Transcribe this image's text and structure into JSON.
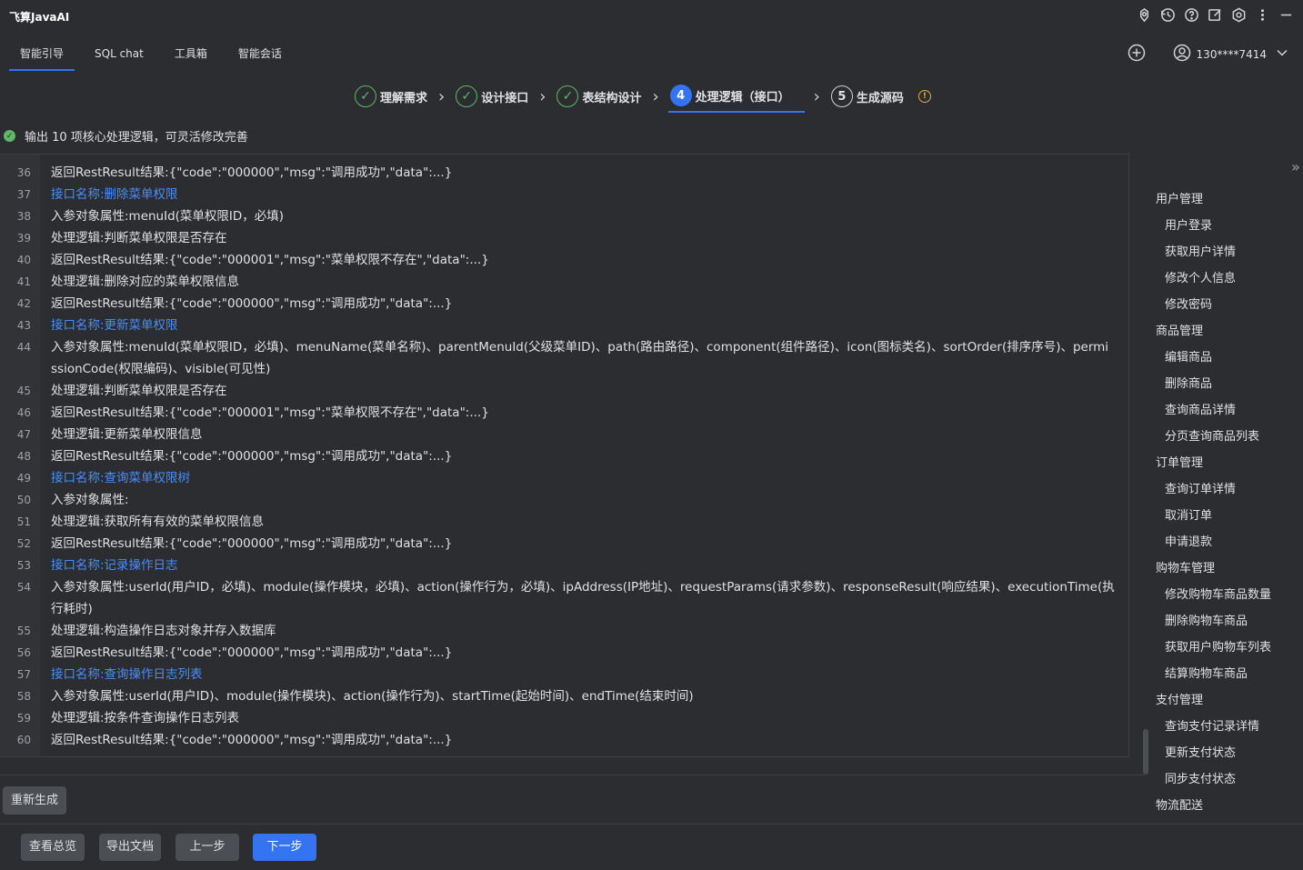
{
  "app": {
    "title": "飞算JavaAI"
  },
  "tabs": [
    {
      "label": "智能引导",
      "active": true
    },
    {
      "label": "SQL chat"
    },
    {
      "label": "工具箱"
    },
    {
      "label": "智能会话"
    }
  ],
  "user": {
    "phone": "130****7414"
  },
  "steps": [
    {
      "label": "理解需求",
      "state": "done"
    },
    {
      "label": "设计接口",
      "state": "done"
    },
    {
      "label": "表结构设计",
      "state": "done"
    },
    {
      "num": "4",
      "label": "处理逻辑（接口）",
      "state": "active"
    },
    {
      "num": "5",
      "label": "生成源码",
      "state": "todo"
    }
  ],
  "status": {
    "text": "输出 10 项核心处理逻辑，可灵活修改完善"
  },
  "editor": {
    "lines": [
      {
        "n": "36",
        "text": "返回RestResult结果:{\"code\":\"000000\",\"msg\":\"调用成功\",\"data\":...}"
      },
      {
        "n": "37",
        "text": "接口名称:删除菜单权限",
        "link": true
      },
      {
        "n": "38",
        "text": "入参对象属性:menuId(菜单权限ID，必填)"
      },
      {
        "n": "39",
        "text": "处理逻辑:判断菜单权限是否存在"
      },
      {
        "n": "40",
        "text": "返回RestResult结果:{\"code\":\"000001\",\"msg\":\"菜单权限不存在\",\"data\":...}"
      },
      {
        "n": "41",
        "text": "处理逻辑:删除对应的菜单权限信息"
      },
      {
        "n": "42",
        "text": "返回RestResult结果:{\"code\":\"000000\",\"msg\":\"调用成功\",\"data\":...}"
      },
      {
        "n": "43",
        "text": "接口名称:更新菜单权限",
        "link": true
      },
      {
        "n": "44",
        "text": "入参对象属性:menuId(菜单权限ID，必填)、menuName(菜单名称)、parentMenuId(父级菜单ID)、path(路由路径)、component(组件路径)、icon(图标类名)、sortOrder(排序序号)、permissionCode(权限编码)、visible(可见性)"
      },
      {
        "n": "45",
        "text": "处理逻辑:判断菜单权限是否存在"
      },
      {
        "n": "46",
        "text": "返回RestResult结果:{\"code\":\"000001\",\"msg\":\"菜单权限不存在\",\"data\":...}"
      },
      {
        "n": "47",
        "text": "处理逻辑:更新菜单权限信息"
      },
      {
        "n": "48",
        "text": "返回RestResult结果:{\"code\":\"000000\",\"msg\":\"调用成功\",\"data\":...}"
      },
      {
        "n": "49",
        "text": "接口名称:查询菜单权限树",
        "link": true
      },
      {
        "n": "50",
        "text": "入参对象属性:"
      },
      {
        "n": "51",
        "text": "处理逻辑:获取所有有效的菜单权限信息"
      },
      {
        "n": "52",
        "text": "返回RestResult结果:{\"code\":\"000000\",\"msg\":\"调用成功\",\"data\":...}"
      },
      {
        "n": "53",
        "text": "接口名称:记录操作日志",
        "link": true
      },
      {
        "n": "54",
        "text": "入参对象属性:userId(用户ID，必填)、module(操作模块，必填)、action(操作行为，必填)、ipAddress(IP地址)、requestParams(请求参数)、responseResult(响应结果)、executionTime(执行耗时)"
      },
      {
        "n": "55",
        "text": "处理逻辑:构造操作日志对象并存入数据库"
      },
      {
        "n": "56",
        "text": "返回RestResult结果:{\"code\":\"000000\",\"msg\":\"调用成功\",\"data\":...}"
      },
      {
        "n": "57",
        "text": "接口名称:查询操作日志列表",
        "link": true
      },
      {
        "n": "58",
        "text": "入参对象属性:userId(用户ID)、module(操作模块)、action(操作行为)、startTime(起始时间)、endTime(结束时间)"
      },
      {
        "n": "59",
        "text": "处理逻辑:按条件查询操作日志列表"
      },
      {
        "n": "60",
        "text": "返回RestResult结果:{\"code\":\"000000\",\"msg\":\"调用成功\",\"data\":...}"
      }
    ]
  },
  "nav": [
    {
      "group": "用户管理",
      "items": [
        "用户登录",
        "获取用户详情",
        "修改个人信息",
        "修改密码"
      ]
    },
    {
      "group": "商品管理",
      "items": [
        "编辑商品",
        "删除商品",
        "查询商品详情",
        "分页查询商品列表"
      ]
    },
    {
      "group": "订单管理",
      "items": [
        "查询订单详情",
        "取消订单",
        "申请退款"
      ]
    },
    {
      "group": "购物车管理",
      "items": [
        "修改购物车商品数量",
        "删除购物车商品",
        "获取用户购物车列表",
        "结算购物车商品"
      ]
    },
    {
      "group": "支付管理",
      "items": [
        "查询支付记录详情",
        "更新支付状态",
        "同步支付状态"
      ]
    },
    {
      "group": "物流配送",
      "items": []
    }
  ],
  "buttons": {
    "regenerate": "重新生成",
    "overview": "查看总览",
    "export": "导出文档",
    "prev": "上一步",
    "next": "下一步"
  },
  "colors": {
    "accent": "#3574f0",
    "success": "#5fb865",
    "link": "#4a8df6",
    "warning": "#e0a83a"
  }
}
